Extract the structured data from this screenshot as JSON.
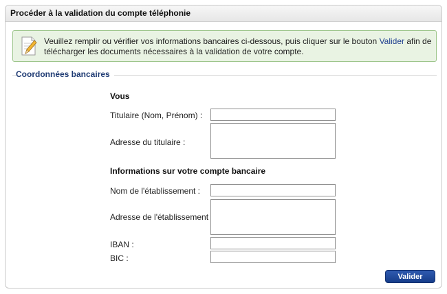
{
  "panel": {
    "title": "Procéder à la validation du compte téléphonie"
  },
  "info": {
    "icon": "note-pencil-icon",
    "text_before": "Veuillez remplir ou vérifier vos informations bancaires ci-dessous, puis cliquer sur le bouton ",
    "link": "Valider",
    "text_after": " afin de télécharger les documents nécessaires à la validation de votre compte."
  },
  "section": {
    "title": "Coordonnées bancaires"
  },
  "vous": {
    "title": "Vous",
    "titulaire_label": "Titulaire (Nom, Prénom) :",
    "titulaire_value": "",
    "adresse_label": "Adresse du titulaire :",
    "adresse_value": ""
  },
  "banque": {
    "title": "Informations sur votre compte bancaire",
    "nom_label": "Nom de l'établissement :",
    "nom_value": "",
    "adresse_label": "Adresse de l'établissement :",
    "adresse_value": "",
    "iban_label": "IBAN :",
    "iban_value": "",
    "bic_label": "BIC :",
    "bic_value": ""
  },
  "actions": {
    "submit_label": "Valider"
  }
}
